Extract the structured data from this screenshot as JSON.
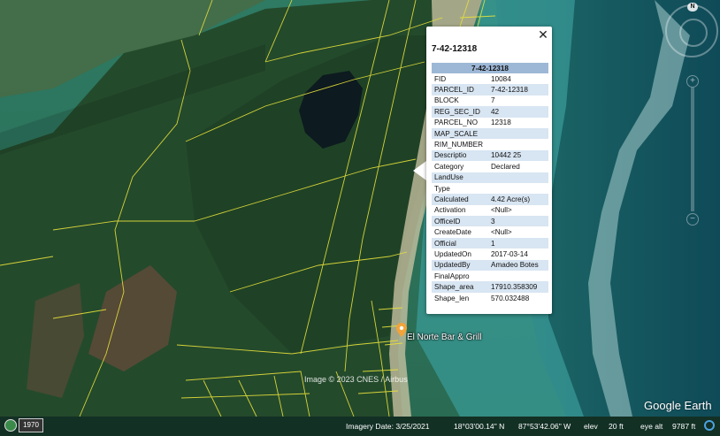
{
  "popup": {
    "title": "7-42-12318",
    "header": "7-42-12318",
    "close_glyph": "✕",
    "rows": [
      {
        "key": "FID",
        "value": "10084"
      },
      {
        "key": "PARCEL_ID",
        "value": "7-42-12318"
      },
      {
        "key": "BLOCK",
        "value": "7"
      },
      {
        "key": "REG_SEC_ID",
        "value": "42"
      },
      {
        "key": "PARCEL_NO",
        "value": "12318"
      },
      {
        "key": "MAP_SCALE",
        "value": ""
      },
      {
        "key": "RIM_NUMBER",
        "value": ""
      },
      {
        "key": "Descriptio",
        "value": "10442 25"
      },
      {
        "key": "Category",
        "value": "Declared"
      },
      {
        "key": "LandUse",
        "value": ""
      },
      {
        "key": "Type",
        "value": ""
      },
      {
        "key": "Calculated",
        "value": "4.42 Acre(s)"
      },
      {
        "key": "Activation",
        "value": "<Null>"
      },
      {
        "key": "OfficeID",
        "value": "3"
      },
      {
        "key": "CreateDate",
        "value": "<Null>"
      },
      {
        "key": "Official",
        "value": "1"
      },
      {
        "key": "UpdatedOn",
        "value": "2017-03-14"
      },
      {
        "key": "UpdatedBy",
        "value": "Amadeo Botes"
      },
      {
        "key": "FinalAppro",
        "value": ""
      },
      {
        "key": "Shape_area",
        "value": "17910.358309"
      },
      {
        "key": "Shape_len",
        "value": "570.032488"
      }
    ]
  },
  "place": {
    "label": "El Norte Bar & Grill",
    "icon": "map-pin-icon"
  },
  "attribution": "Image © 2023 CNES / Airbus",
  "brand": "Google Earth",
  "navigation": {
    "north_label": "N"
  },
  "status_bar": {
    "year": "1970",
    "imagery_date": "Imagery Date: 3/25/2021",
    "latitude": "18°03'00.14\" N",
    "longitude": "87°53'42.06\" W",
    "elev_label": "elev",
    "elev_value": "20 ft",
    "eye_alt_label": "eye alt",
    "eye_alt_value": "9787 ft"
  },
  "colors": {
    "parcel_line": "#e8e23a",
    "popup_header": "#9db8d6",
    "popup_alt_row": "#d8e5f2"
  }
}
